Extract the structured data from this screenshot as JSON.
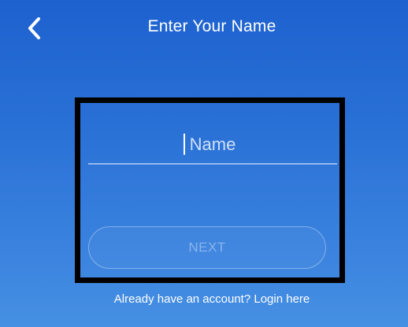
{
  "header": {
    "title": "Enter Your Name",
    "back_icon": "chevron-left-icon"
  },
  "form": {
    "name_placeholder": "Name",
    "name_value": "",
    "next_label": "NEXT",
    "next_enabled": false
  },
  "footer": {
    "login_text": "Already have an account? Login here"
  },
  "colors": {
    "background_top": "#1d61cf",
    "background_bottom": "#4690e3",
    "text": "#ffffff",
    "highlight_frame": "#000000"
  }
}
